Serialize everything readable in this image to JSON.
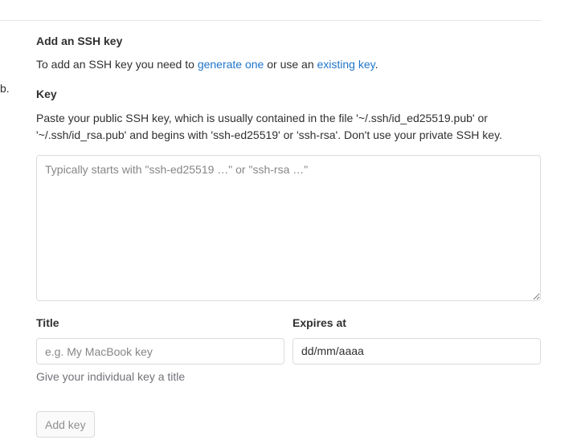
{
  "left_fragment": "b.",
  "section": {
    "title": "Add an SSH key",
    "intro_prefix": "To add an SSH key you need to ",
    "generate_link": "generate one",
    "intro_middle": " or use an ",
    "existing_link": "existing key",
    "intro_suffix": "."
  },
  "key": {
    "label": "Key",
    "help": "Paste your public SSH key, which is usually contained in the file '~/.ssh/id_ed25519.pub' or '~/.ssh/id_rsa.pub' and begins with 'ssh-ed25519' or 'ssh-rsa'. Don't use your private SSH key.",
    "placeholder": "Typically starts with \"ssh-ed25519 …\" or \"ssh-rsa …\"",
    "value": ""
  },
  "title_field": {
    "label": "Title",
    "placeholder": "e.g. My MacBook key",
    "value": "",
    "help": "Give your individual key a title"
  },
  "expires_field": {
    "label": "Expires at",
    "value": "dd/mm/aaaa"
  },
  "submit": {
    "label": "Add key",
    "disabled": true
  }
}
